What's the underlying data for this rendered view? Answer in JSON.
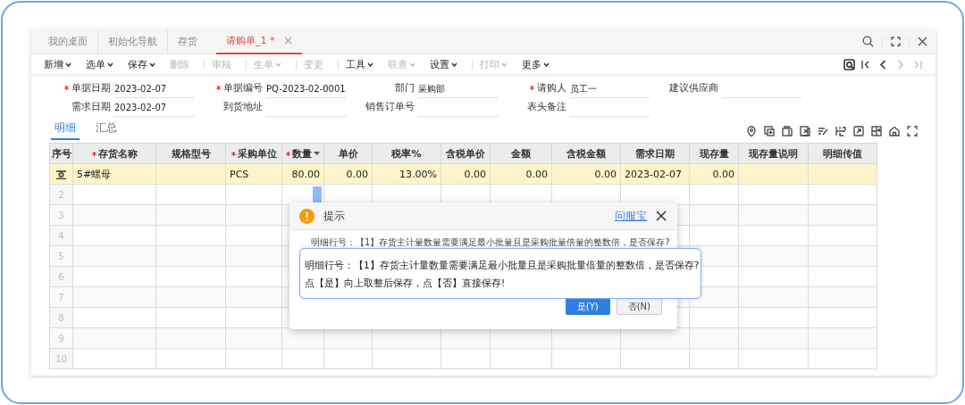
{
  "page_tabs": [
    {
      "label": "我的桌面",
      "selected": false,
      "closable": false
    },
    {
      "label": "初始化导航",
      "selected": false,
      "closable": false
    },
    {
      "label": "存货",
      "selected": false,
      "closable": false
    },
    {
      "label": "请购单_1 *",
      "selected": true,
      "closable": true
    }
  ],
  "toolbar": [
    {
      "label": "新增",
      "dropdown": true,
      "disabled": false,
      "divider_before": false
    },
    {
      "label": "选单",
      "dropdown": true,
      "disabled": false,
      "divider_before": false
    },
    {
      "label": "保存",
      "dropdown": true,
      "disabled": false,
      "divider_before": false
    },
    {
      "label": "删除",
      "dropdown": false,
      "disabled": true,
      "divider_before": false
    },
    {
      "label": "审核",
      "dropdown": false,
      "disabled": true,
      "divider_before": true
    },
    {
      "label": "生单",
      "dropdown": true,
      "disabled": true,
      "divider_before": true
    },
    {
      "label": "变更",
      "dropdown": false,
      "disabled": true,
      "divider_before": true
    },
    {
      "label": "工具",
      "dropdown": true,
      "disabled": false,
      "divider_before": true
    },
    {
      "label": "联查",
      "dropdown": true,
      "disabled": true,
      "divider_before": false
    },
    {
      "label": "设置",
      "dropdown": true,
      "disabled": false,
      "divider_before": false
    },
    {
      "label": "打印",
      "dropdown": true,
      "disabled": true,
      "divider_before": true
    },
    {
      "label": "更多",
      "dropdown": true,
      "disabled": false,
      "divider_before": false
    }
  ],
  "record_nav": [
    {
      "kind": "preview",
      "disabled": false
    },
    {
      "kind": "first",
      "disabled": false
    },
    {
      "kind": "prev",
      "disabled": false
    },
    {
      "kind": "next",
      "disabled": true
    },
    {
      "kind": "last",
      "disabled": true
    }
  ],
  "header_fields": [
    {
      "label": "单据日期",
      "value": "2023-02-07",
      "required": true
    },
    {
      "label": "单据编号",
      "value": "PQ-2023-02-0001",
      "required": true
    },
    {
      "label": "部门",
      "value": "采购部",
      "required": false
    },
    {
      "label": "请购人",
      "value": "员工一",
      "required": true
    },
    {
      "label": "建议供应商",
      "required": false
    },
    {
      "label": "需求日期",
      "value": "2023-02-07",
      "required": false
    },
    {
      "label": "到货地址",
      "required": false
    },
    {
      "label": "销售订单号",
      "required": false
    },
    {
      "label": "表头备注",
      "required": false
    }
  ],
  "detail_tabs": [
    {
      "label": "明细",
      "selected": true
    },
    {
      "label": "汇总",
      "selected": false
    }
  ],
  "table": {
    "columns": [
      {
        "label": "序号",
        "required": false,
        "sortable": false
      },
      {
        "label": "存货名称",
        "required": true,
        "sortable": false
      },
      {
        "label": "规格型号",
        "required": false,
        "sortable": false
      },
      {
        "label": "采购单位",
        "required": true,
        "sortable": false
      },
      {
        "label": "数量",
        "required": true,
        "sortable": true
      },
      {
        "label": "单价",
        "required": false,
        "sortable": false
      },
      {
        "label": "税率%",
        "required": false,
        "sortable": false
      },
      {
        "label": "含税单价",
        "required": false,
        "sortable": false
      },
      {
        "label": "金额",
        "required": false,
        "sortable": false
      },
      {
        "label": "含税金额",
        "required": false,
        "sortable": false
      },
      {
        "label": "需求日期",
        "required": false,
        "sortable": false
      },
      {
        "label": "现存量",
        "required": false,
        "sortable": false
      },
      {
        "label": "现存量说明",
        "required": false,
        "sortable": false
      },
      {
        "label": "明细传值",
        "required": false,
        "sortable": false
      }
    ],
    "rows": [
      {
        "selected": true,
        "cells": [
          "5#螺母",
          null,
          "PCS",
          "80.00",
          "0.00",
          "13.00%",
          "0.00",
          "0.00",
          "0.00",
          "2023-02-07",
          "0.00",
          null,
          null
        ]
      },
      {
        "number": "2",
        "selected": false
      },
      {
        "number": "3",
        "selected": false
      },
      {
        "number": "4",
        "selected": false
      },
      {
        "number": "5",
        "selected": false
      },
      {
        "number": "6",
        "selected": false
      },
      {
        "number": "7",
        "selected": false
      },
      {
        "number": "8",
        "selected": false
      },
      {
        "number": "9",
        "selected": false
      },
      {
        "number": "10",
        "selected": false
      }
    ]
  },
  "dialog": {
    "title": "提示",
    "help_link": "问服宝",
    "message": "明细行号：【1】存货主计量数量需要满足最小批量且是采购批量倍量的整数倍，是否保存?",
    "tooltip": [
      "明细行号：【1】存货主计量数量需要满足最小批量且是采购批量倍量的整数倍，是否保存?",
      "点【是】向上取整后保存，点【否】直接保存!"
    ],
    "buttons": [
      {
        "label": "是(Y)",
        "kind": "primary"
      },
      {
        "label": "否(N)",
        "kind": "default"
      }
    ]
  }
}
